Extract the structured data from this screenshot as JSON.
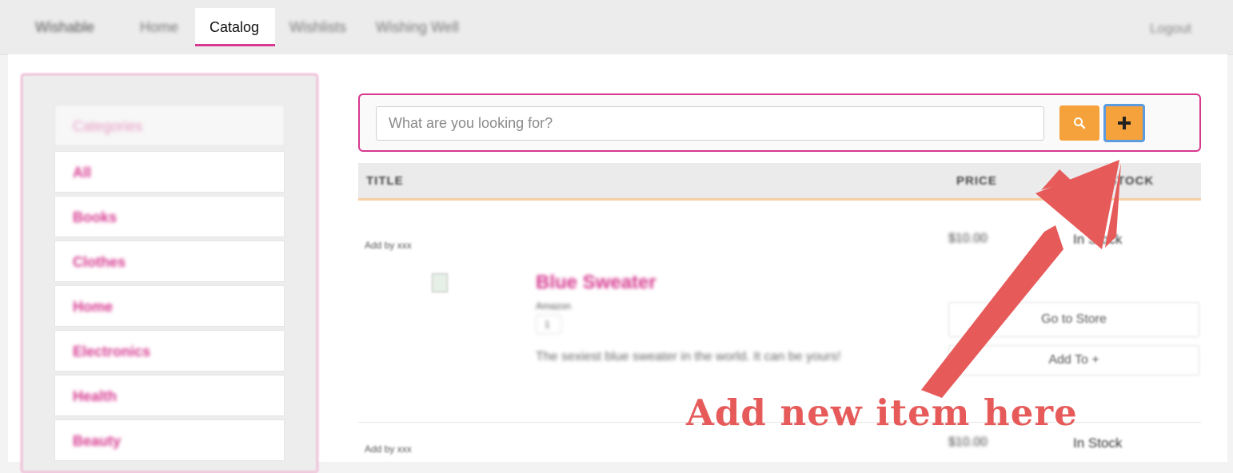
{
  "nav": {
    "brand": "Wishable",
    "links": [
      "Home",
      "Catalog",
      "Wishlists",
      "Wishing Well"
    ],
    "active": "Catalog",
    "logout": "Logout"
  },
  "sidebar": {
    "header": "Categories",
    "items": [
      "All",
      "Books",
      "Clothes",
      "Home",
      "Electronics",
      "Health",
      "Beauty"
    ]
  },
  "search": {
    "placeholder": "What are you looking for?",
    "search_icon": "search-icon",
    "add_icon": "plus-icon"
  },
  "table": {
    "headers": {
      "title": "TITLE",
      "price": "PRICE",
      "stock": "STOCK"
    },
    "rows": [
      {
        "added_by": "Add by xxx",
        "price": "$10.00",
        "stock": "In Stock",
        "title": "Blue Sweater",
        "store": "Amazon",
        "qty": "1",
        "description": "The sexiest blue sweater in the world. It can be yours!",
        "go_to_store": "Go to Store",
        "add_to": "Add To +"
      },
      {
        "added_by": "Add by xxx",
        "price": "$10.00",
        "stock": "In Stock"
      }
    ]
  },
  "annotation": {
    "text": "Add new item here",
    "color": "#e65a5a"
  },
  "colors": {
    "accent": "#d6398f",
    "button": "#f6a23c"
  }
}
